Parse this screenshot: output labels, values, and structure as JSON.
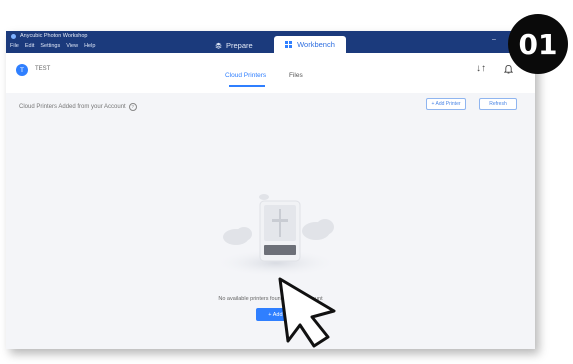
{
  "titlebar": {
    "app_name": "Anycubic Photon Workshop",
    "menu": [
      "File",
      "Edit",
      "Settings",
      "View",
      "Help"
    ],
    "tabs": {
      "prepare": "Prepare",
      "workbench": "Workbench"
    },
    "minimize": "–"
  },
  "header": {
    "avatar_initial": "T",
    "username": "TEST",
    "tabs": {
      "cloud_printers": "Cloud Printers",
      "files": "Files"
    },
    "sort_icon_glyph": "↓↑"
  },
  "panel": {
    "section_title": "Cloud Printers Added from your Account",
    "help_glyph": "?",
    "add_printer_button": "+ Add Printer",
    "refresh_button": "Refresh",
    "empty_message": "No available printers found in your account",
    "add_button_label": "+ Add P"
  },
  "badge": {
    "step": "01"
  },
  "colors": {
    "titlebar": "#1b3a7c",
    "accent": "#2f7fff",
    "panel_bg": "#f4f5f8"
  },
  "icons": [
    "app-logo-icon",
    "prepare-icon",
    "workbench-icon",
    "sort-icon",
    "bell-icon",
    "help-icon",
    "printer-illustration",
    "cursor-arrow-icon"
  ]
}
